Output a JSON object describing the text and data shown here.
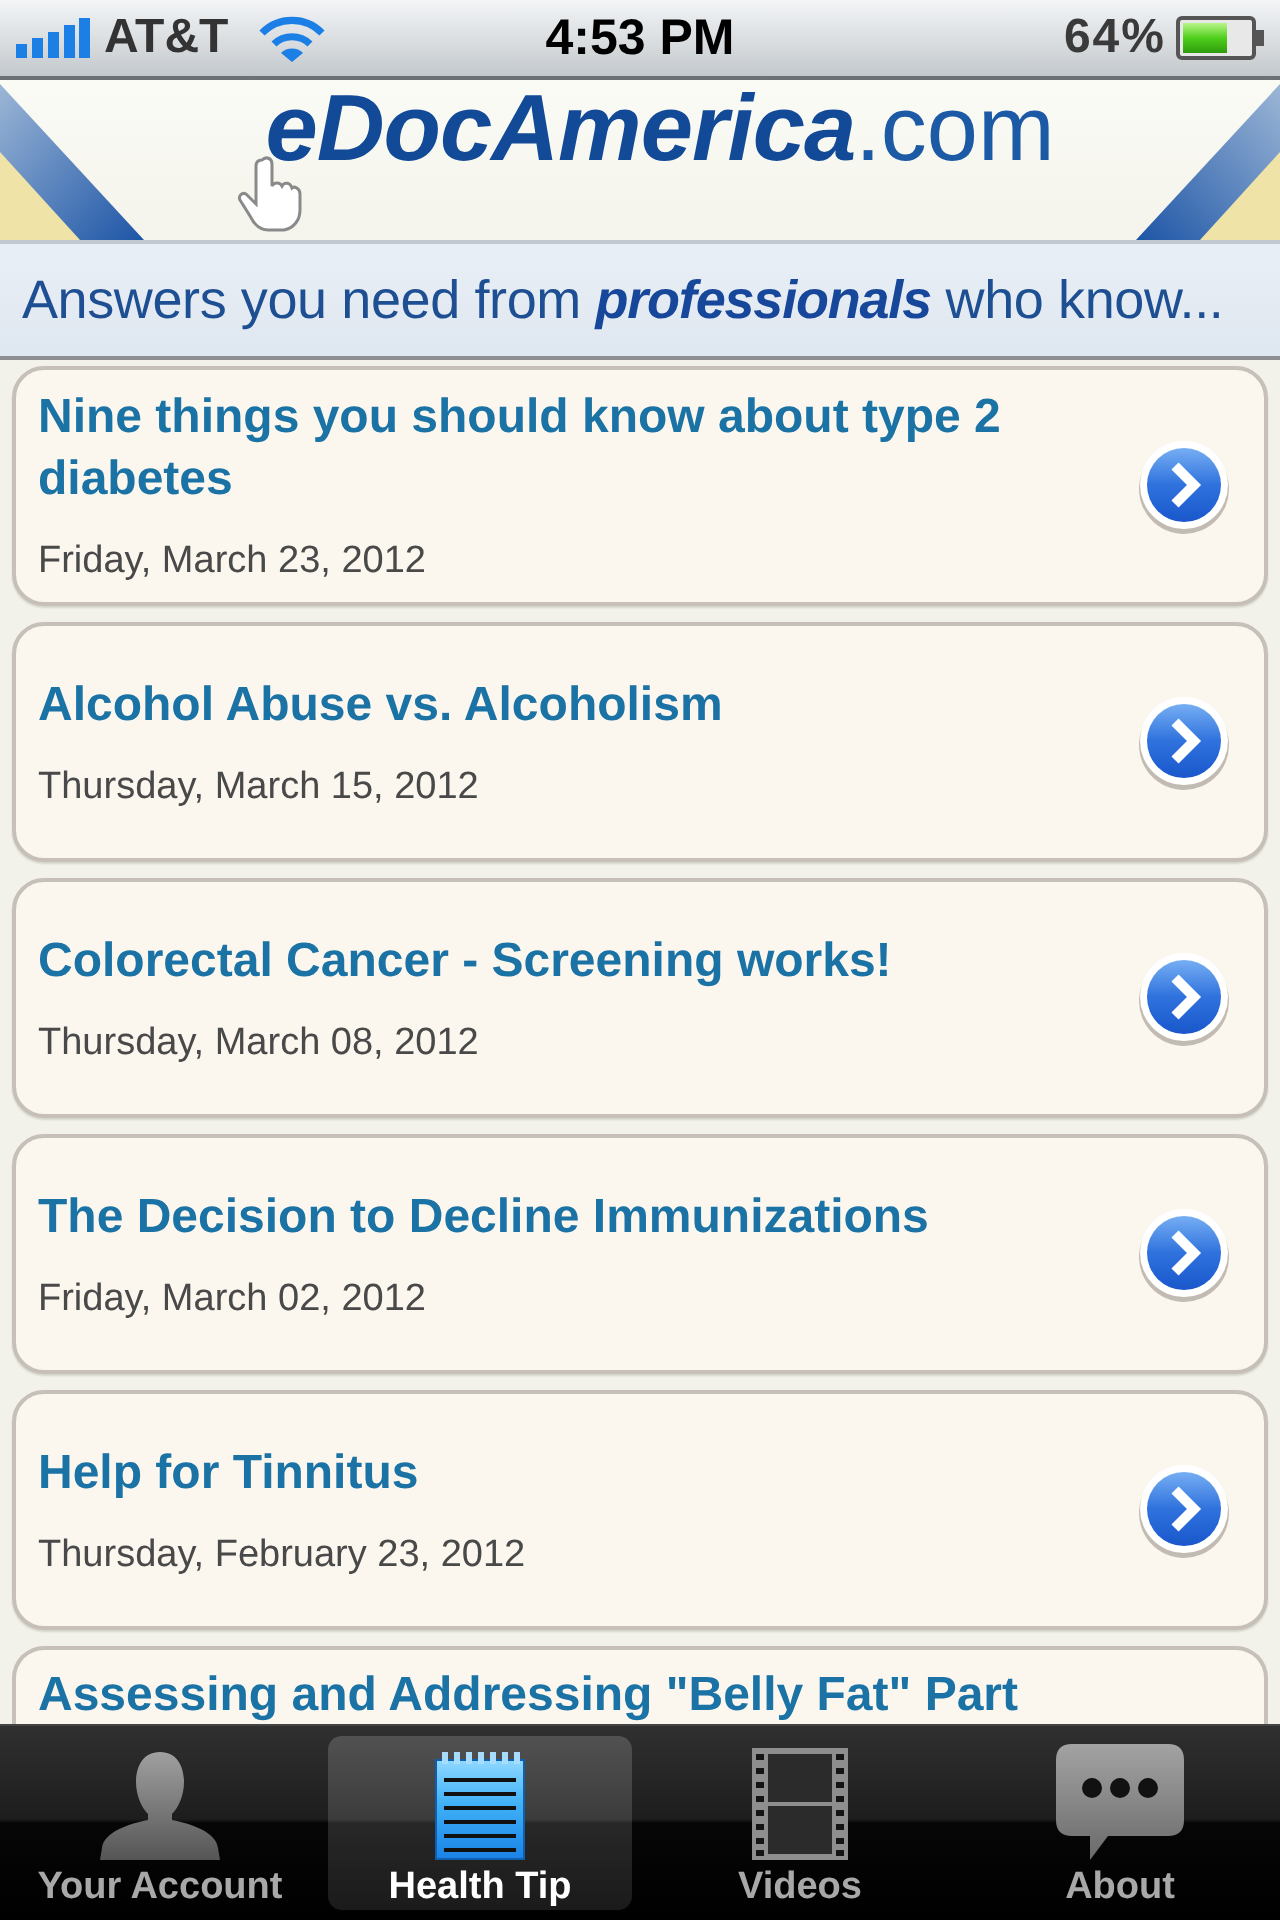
{
  "status_bar": {
    "carrier": "AT&T",
    "time": "4:53 PM",
    "battery": "64%"
  },
  "header": {
    "logo": "**eDocAmerica**.com",
    "tagline": "Answers you need from **professionals** who know..."
  },
  "tips": [
    {
      "title": "Nine things you should know about type 2 diabetes",
      "date": "Friday, March 23, 2012"
    },
    {
      "title": "Alcohol Abuse vs. Alcoholism",
      "date": "Thursday, March 15, 2012"
    },
    {
      "title": "Colorectal Cancer - Screening works!",
      "date": "Thursday, March 08, 2012"
    },
    {
      "title": "The Decision to Decline Immunizations",
      "date": "Friday, March 02, 2012"
    },
    {
      "title": "Help for Tinnitus",
      "date": "Thursday, February 23, 2012"
    },
    {
      "title": "Assessing and Addressing \"Belly Fat\" Part"
    }
  ],
  "tab_bar": {
    "tabs": [
      {
        "label": "Your Account",
        "kind": "person",
        "selected": false
      },
      {
        "label": "Health Tip",
        "kind": "notepad",
        "selected": true
      },
      {
        "label": "Videos",
        "kind": "film",
        "selected": false
      },
      {
        "label": "About",
        "kind": "chat",
        "selected": false
      }
    ]
  }
}
